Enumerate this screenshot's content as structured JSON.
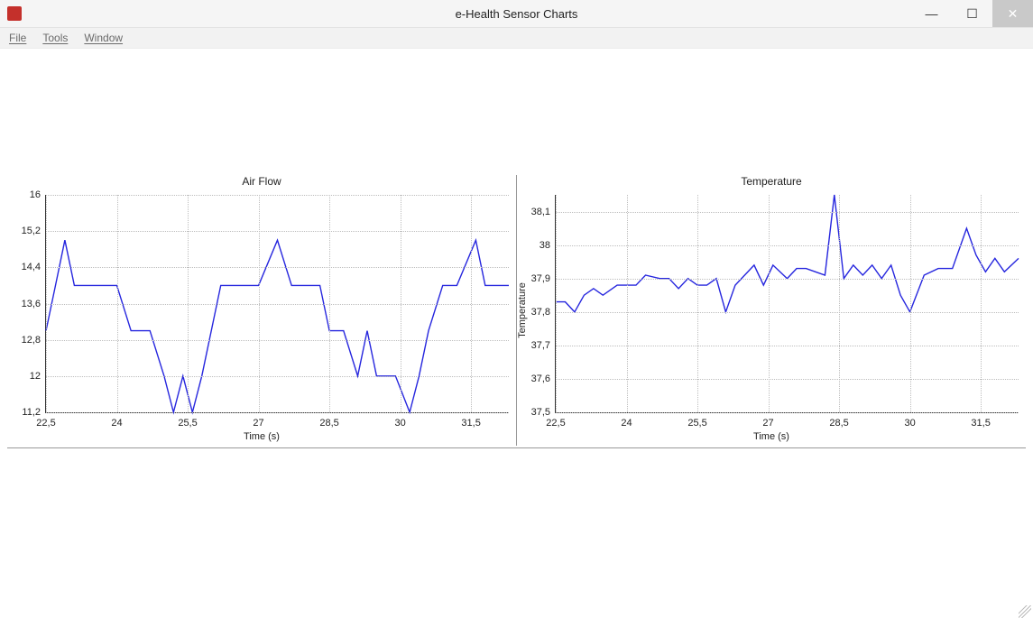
{
  "window": {
    "title": "e-Health Sensor Charts"
  },
  "menu": {
    "items": [
      "File",
      "Tools",
      "Window"
    ]
  },
  "chart_data": [
    {
      "type": "line",
      "title": "Air Flow",
      "xlabel": "Time (s)",
      "ylabel": "",
      "xlim": [
        22.5,
        32.3
      ],
      "ylim": [
        11.2,
        16
      ],
      "xticks": [
        22.5,
        24,
        25.5,
        27,
        28.5,
        30,
        31.5
      ],
      "xtick_labels": [
        "22,5",
        "24",
        "25,5",
        "27",
        "28,5",
        "30",
        "31,5"
      ],
      "yticks": [
        11.2,
        12,
        12.8,
        13.6,
        14.4,
        15.2,
        16
      ],
      "ytick_labels": [
        "11,2",
        "12",
        "12,8",
        "13,6",
        "14,4",
        "15,2",
        "16"
      ],
      "x": [
        22.5,
        22.7,
        22.9,
        23.1,
        23.3,
        23.6,
        24.0,
        24.3,
        24.7,
        25.0,
        25.2,
        25.4,
        25.6,
        25.8,
        26.0,
        26.2,
        26.5,
        27.0,
        27.4,
        27.7,
        28.0,
        28.3,
        28.5,
        28.8,
        29.1,
        29.3,
        29.5,
        29.9,
        30.2,
        30.4,
        30.6,
        30.9,
        31.2,
        31.6,
        31.8,
        32.0,
        32.3
      ],
      "values": [
        13.0,
        14.0,
        15.0,
        14.0,
        14.0,
        14.0,
        14.0,
        13.0,
        13.0,
        12.0,
        11.2,
        12.0,
        11.2,
        12.0,
        13.0,
        14.0,
        14.0,
        14.0,
        15.0,
        14.0,
        14.0,
        14.0,
        13.0,
        13.0,
        12.0,
        13.0,
        12.0,
        12.0,
        11.2,
        12.0,
        13.0,
        14.0,
        14.0,
        15.0,
        14.0,
        14.0,
        14.0
      ]
    },
    {
      "type": "line",
      "title": "Temperature",
      "xlabel": "Time (s)",
      "ylabel": "Temperature",
      "xlim": [
        22.5,
        32.3
      ],
      "ylim": [
        37.5,
        38.15
      ],
      "xticks": [
        22.5,
        24,
        25.5,
        27,
        28.5,
        30,
        31.5
      ],
      "xtick_labels": [
        "22,5",
        "24",
        "25,5",
        "27",
        "28,5",
        "30",
        "31,5"
      ],
      "yticks": [
        37.5,
        37.6,
        37.7,
        37.8,
        37.9,
        38.0,
        38.1
      ],
      "ytick_labels": [
        "37,5",
        "37,6",
        "37,7",
        "37,8",
        "37,9",
        "38",
        "38,1"
      ],
      "x": [
        22.5,
        22.7,
        22.9,
        23.1,
        23.3,
        23.5,
        23.8,
        24.0,
        24.2,
        24.4,
        24.7,
        24.9,
        25.1,
        25.3,
        25.5,
        25.7,
        25.9,
        26.1,
        26.3,
        26.5,
        26.7,
        26.9,
        27.1,
        27.4,
        27.6,
        27.8,
        28.0,
        28.2,
        28.4,
        28.6,
        28.8,
        29.0,
        29.2,
        29.4,
        29.6,
        29.8,
        30.0,
        30.3,
        30.6,
        30.9,
        31.2,
        31.4,
        31.6,
        31.8,
        32.0,
        32.3
      ],
      "values": [
        37.83,
        37.83,
        37.8,
        37.85,
        37.87,
        37.85,
        37.88,
        37.88,
        37.88,
        37.91,
        37.9,
        37.9,
        37.87,
        37.9,
        37.88,
        37.88,
        37.9,
        37.8,
        37.88,
        37.91,
        37.94,
        37.88,
        37.94,
        37.9,
        37.93,
        37.93,
        37.92,
        37.91,
        38.15,
        37.9,
        37.94,
        37.91,
        37.94,
        37.9,
        37.94,
        37.85,
        37.8,
        37.91,
        37.93,
        37.93,
        38.05,
        37.97,
        37.92,
        37.96,
        37.92,
        37.96
      ]
    }
  ]
}
